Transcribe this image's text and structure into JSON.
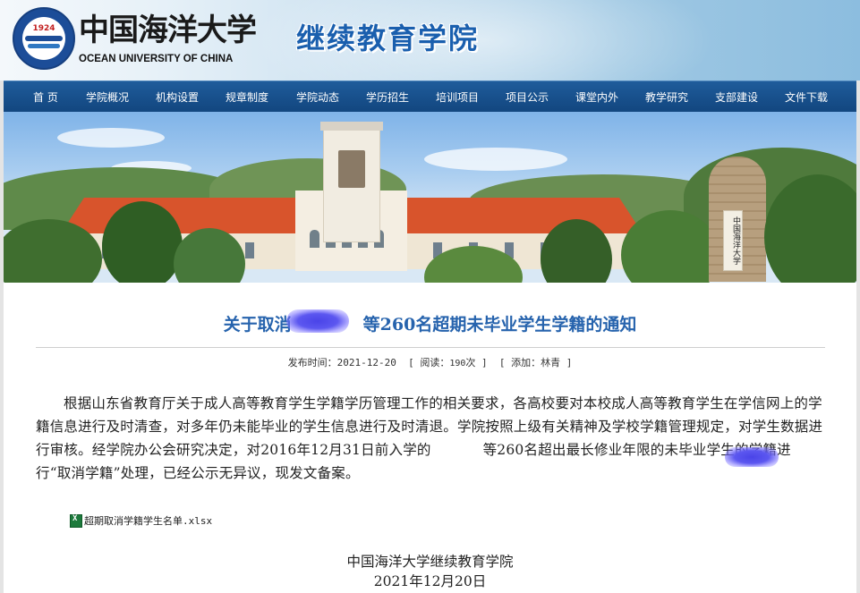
{
  "header": {
    "logo_year": "1924",
    "university_cn": "中国海洋大学",
    "university_en": "OCEAN UNIVERSITY OF CHINA",
    "site_title": "继续教育学院"
  },
  "nav": {
    "items": [
      "首 页",
      "学院概况",
      "机构设置",
      "规章制度",
      "学院动态",
      "学历招生",
      "培训项目",
      "项目公示",
      "课堂内外",
      "教学研究",
      "支部建设",
      "文件下载"
    ]
  },
  "banner": {
    "plate_text": "中国海洋大学"
  },
  "article": {
    "title_prefix": "关于取消",
    "title_suffix": "等260名超期未毕业学生学籍的通知",
    "meta_publish_label": "发布时间：",
    "meta_publish_date": "2021-12-20",
    "meta_views_label": "[ 阅读：",
    "meta_views_count": "190",
    "meta_views_suffix": "次 ]",
    "meta_author_label": "[ 添加：",
    "meta_author": "林青",
    "meta_author_suffix": "]",
    "body_part1": "根据山东省教育厅关于成人高等教育学生学籍学历管理工作的相关要求，各高校要对本校成人高等教育学生在学信网上的学籍信息进行及时清查，对多年仍未能毕业的学生信息进行及时清退。学院按照上级有关精神及学校学籍管理规定，对学生数据进行审核。经学院办公会研究决定，对2016年12月31日前入学的",
    "body_part2": "等260名超出最长修业年限的未毕业学生的学籍进行“取消学籍”处理，已经公示无异议，现发文备案。",
    "attachment": "超期取消学籍学生名单.xlsx",
    "sign_org": "中国海洋大学继续教育学院",
    "sign_date": "2021年12月20日"
  },
  "colors": {
    "nav_bg": "#1a5590",
    "title_blue": "#2663ad",
    "redaction": "#4a44e8"
  }
}
